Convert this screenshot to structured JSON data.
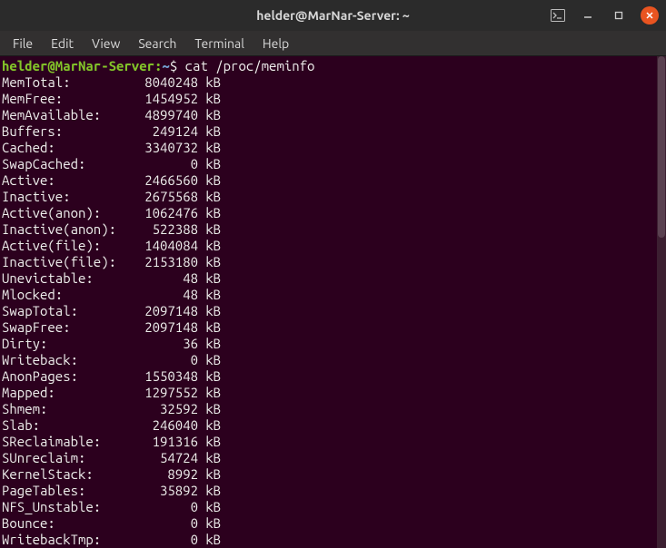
{
  "window": {
    "title": "helder@MarNar-Server: ~"
  },
  "menu": {
    "items": [
      "File",
      "Edit",
      "View",
      "Search",
      "Terminal",
      "Help"
    ]
  },
  "prompt": {
    "userhost": "helder@MarNar-Server",
    "colon": ":",
    "path": "~",
    "symbol": "$ ",
    "command": "cat /proc/meminfo"
  },
  "meminfo": [
    {
      "label": "MemTotal:",
      "value": "8040248",
      "unit": "kB"
    },
    {
      "label": "MemFree:",
      "value": "1454952",
      "unit": "kB"
    },
    {
      "label": "MemAvailable:",
      "value": "4899740",
      "unit": "kB"
    },
    {
      "label": "Buffers:",
      "value": "249124",
      "unit": "kB"
    },
    {
      "label": "Cached:",
      "value": "3340732",
      "unit": "kB"
    },
    {
      "label": "SwapCached:",
      "value": "0",
      "unit": "kB"
    },
    {
      "label": "Active:",
      "value": "2466560",
      "unit": "kB"
    },
    {
      "label": "Inactive:",
      "value": "2675568",
      "unit": "kB"
    },
    {
      "label": "Active(anon):",
      "value": "1062476",
      "unit": "kB"
    },
    {
      "label": "Inactive(anon):",
      "value": "522388",
      "unit": "kB"
    },
    {
      "label": "Active(file):",
      "value": "1404084",
      "unit": "kB"
    },
    {
      "label": "Inactive(file):",
      "value": "2153180",
      "unit": "kB"
    },
    {
      "label": "Unevictable:",
      "value": "48",
      "unit": "kB"
    },
    {
      "label": "Mlocked:",
      "value": "48",
      "unit": "kB"
    },
    {
      "label": "SwapTotal:",
      "value": "2097148",
      "unit": "kB"
    },
    {
      "label": "SwapFree:",
      "value": "2097148",
      "unit": "kB"
    },
    {
      "label": "Dirty:",
      "value": "36",
      "unit": "kB"
    },
    {
      "label": "Writeback:",
      "value": "0",
      "unit": "kB"
    },
    {
      "label": "AnonPages:",
      "value": "1550348",
      "unit": "kB"
    },
    {
      "label": "Mapped:",
      "value": "1297552",
      "unit": "kB"
    },
    {
      "label": "Shmem:",
      "value": "32592",
      "unit": "kB"
    },
    {
      "label": "Slab:",
      "value": "246040",
      "unit": "kB"
    },
    {
      "label": "SReclaimable:",
      "value": "191316",
      "unit": "kB"
    },
    {
      "label": "SUnreclaim:",
      "value": "54724",
      "unit": "kB"
    },
    {
      "label": "KernelStack:",
      "value": "8992",
      "unit": "kB"
    },
    {
      "label": "PageTables:",
      "value": "35892",
      "unit": "kB"
    },
    {
      "label": "NFS_Unstable:",
      "value": "0",
      "unit": "kB"
    },
    {
      "label": "Bounce:",
      "value": "0",
      "unit": "kB"
    },
    {
      "label": "WritebackTmp:",
      "value": "0",
      "unit": "kB"
    }
  ]
}
